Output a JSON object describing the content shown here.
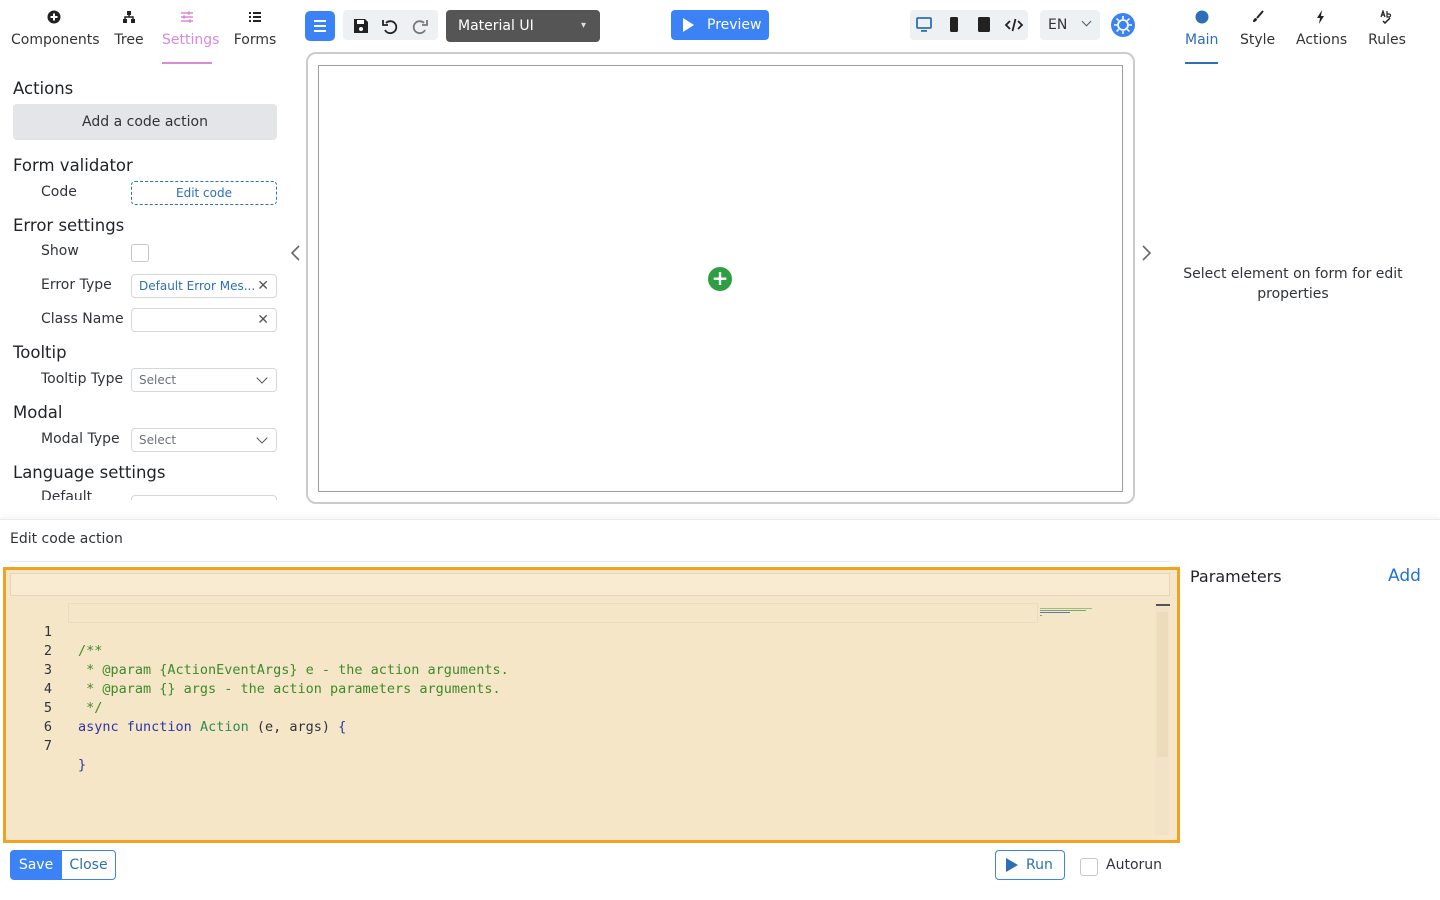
{
  "left_tabs": [
    {
      "label": "Components",
      "icon": "plus-circle-icon"
    },
    {
      "label": "Tree",
      "icon": "tree-icon"
    },
    {
      "label": "Settings",
      "icon": "settings-sliders-icon"
    },
    {
      "label": "Forms",
      "icon": "list-icon"
    }
  ],
  "left_panel": {
    "actions_title": "Actions",
    "add_code_action": "Add a code action",
    "form_validator_title": "Form validator",
    "code_label": "Code",
    "edit_code": "Edit code",
    "error_settings_title": "Error settings",
    "show_label": "Show",
    "error_type_label": "Error Type",
    "error_type_value": "Default Error Mes...",
    "class_name_label": "Class Name",
    "class_name_value": "",
    "tooltip_title": "Tooltip",
    "tooltip_type_label": "Tooltip Type",
    "tooltip_type_placeholder": "Select",
    "modal_title": "Modal",
    "modal_type_label": "Modal Type",
    "modal_type_placeholder": "Select",
    "language_settings_title": "Language settings",
    "default_label": "Default"
  },
  "toolbar": {
    "theme": "Material UI",
    "preview": "Preview",
    "language": "EN"
  },
  "right_tabs": [
    {
      "label": "Main",
      "icon": "circle-icon"
    },
    {
      "label": "Style",
      "icon": "brush-icon"
    },
    {
      "label": "Actions",
      "icon": "lightning-icon"
    },
    {
      "label": "Rules",
      "icon": "spellcheck-icon"
    }
  ],
  "right_panel": {
    "hint": "Select element on form for edit properties"
  },
  "editor": {
    "title": "Edit code action",
    "lines": [
      {
        "n": "1",
        "text": "/**"
      },
      {
        "n": "2",
        "text": " * @param {ActionEventArgs} e - the action arguments."
      },
      {
        "n": "3",
        "text": " * @param {} args - the action parameters arguments."
      },
      {
        "n": "4",
        "text": " */"
      },
      {
        "n": "5",
        "text": "async function Action (e, args) {"
      },
      {
        "n": "6",
        "text": ""
      },
      {
        "n": "7",
        "text": "}"
      }
    ],
    "parameters_title": "Parameters",
    "parameters_add": "Add",
    "save": "Save",
    "close": "Close",
    "run": "Run",
    "autorun": "Autorun"
  },
  "colors": {
    "accent_blue": "#3b82f6",
    "settings_pink": "#d98ad9",
    "highlight_orange": "#f0a321",
    "add_green": "#2e9e43"
  }
}
